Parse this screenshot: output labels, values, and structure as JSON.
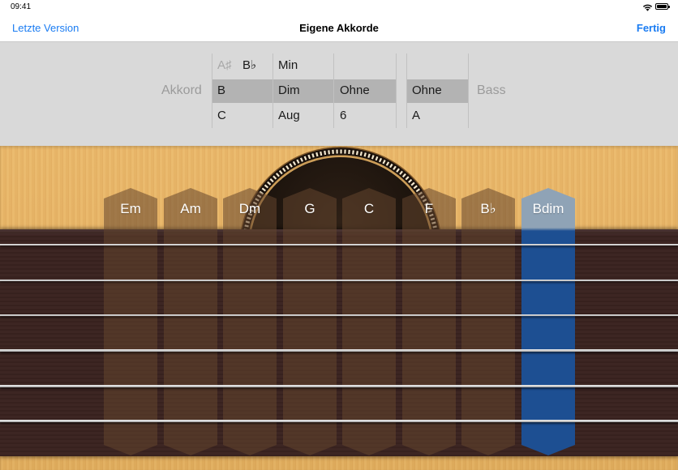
{
  "status_bar": {
    "time": "09:41",
    "icons": [
      "wifi-icon",
      "battery-icon"
    ]
  },
  "nav_bar": {
    "back_label": "Letzte Version",
    "title": "Eigene Akkorde",
    "done_label": "Fertig",
    "accent_color": "#1a7cf2"
  },
  "chord_picker": {
    "chord_label": "Akkord",
    "bass_label": "Bass",
    "background_color": "#d9d9d9",
    "selection_color": "#b3b3b3",
    "root_column": {
      "above": [
        "A♯",
        "B♭"
      ],
      "selected": "B",
      "below": "C"
    },
    "quality_column": {
      "above": "Min",
      "selected": "Dim",
      "below": "Aug"
    },
    "extension_column": {
      "selected": "Ohne",
      "below": "6"
    },
    "bass_column": {
      "selected": "Ohne",
      "below": "A"
    }
  },
  "chord_strips": {
    "chords": [
      "Em",
      "Am",
      "Dm",
      "G",
      "C",
      "F",
      "B♭",
      "Bdim"
    ],
    "selected_index": 7,
    "selected_color": "#1d4f92"
  },
  "guitar": {
    "string_count": 6,
    "wood_color": "#e9b462",
    "fretboard_color": "#3a2320"
  }
}
